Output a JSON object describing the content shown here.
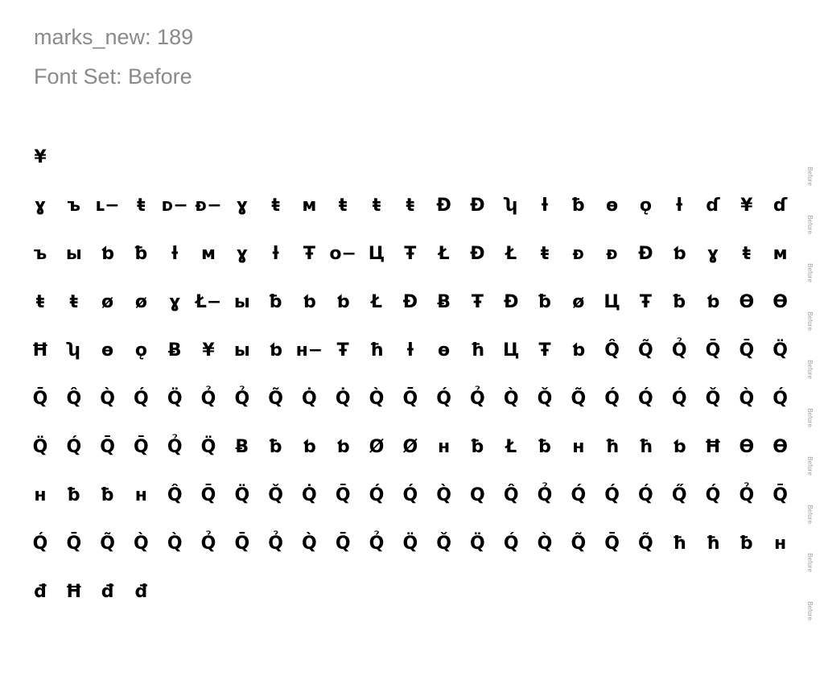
{
  "header": {
    "count_label": "marks_new: 189",
    "font_set_label": "Font Set: Before"
  },
  "side_label": "Before",
  "rows": [
    [
      "¥"
    ],
    [
      "ɣ",
      "ъ",
      "ʟ−",
      "ŧ",
      "ᴅ−",
      "ᴆ−",
      "ɣ",
      "ŧ",
      "ᴍ",
      "ŧ",
      "ŧ",
      "ŧ",
      "Đ",
      "Đ",
      "ʮ",
      "ƚ",
      "ƀ",
      "ɵ",
      "ǫ",
      "ƚ",
      "ɗ",
      "¥",
      "ɗ"
    ],
    [
      "ъ",
      "ы",
      "ƅ",
      "ƀ",
      "ƚ",
      "ᴍ",
      "ɣ",
      "ƚ",
      "Ŧ",
      "ᴏ−",
      "Ц",
      "Ŧ",
      "Ł",
      "Đ",
      "Ł",
      "ŧ",
      "ᴆ",
      "ᴆ",
      "Đ",
      "ƅ",
      "ɣ",
      "ŧ",
      "ᴍ"
    ],
    [
      "ŧ",
      "ŧ",
      "ø",
      "ø",
      "ɣ",
      "Ł−",
      "ы",
      "ƀ",
      "ƅ",
      "ƅ",
      "Ł",
      "Đ",
      "Ƀ",
      "Ŧ",
      "Đ",
      "ƀ",
      "ø",
      "Ц",
      "Ŧ",
      "ƀ",
      "ƅ",
      "Ɵ",
      "Ɵ"
    ],
    [
      "Ħ",
      "ʮ",
      "ɵ",
      "ǫ",
      "Ƀ",
      "¥",
      "ы",
      "ƅ",
      "ʜ−",
      "Ŧ",
      "ħ",
      "ƚ",
      "ɵ",
      "ħ",
      "Ц",
      "Ŧ",
      "ƅ",
      "Q̂",
      "Q̃",
      "Q̉",
      "Q̄",
      "Q̄",
      "Q̈"
    ],
    [
      "Q̄",
      "Q̂",
      "Q̀",
      "Q́",
      "Q̈",
      "Q̉",
      "Q̉",
      "Q̃",
      "Q̇",
      "Q̇",
      "Q̀",
      "Q̄",
      "Q́",
      "Q̉",
      "Q̀",
      "Q̌",
      "Q̃",
      "Q́",
      "Q́",
      "Q́",
      "Q̌",
      "Q̀",
      "Q́"
    ],
    [
      "Q̈",
      "Q́",
      "Q̄",
      "Q̄",
      "Q̉",
      "Q̈",
      "Ƀ",
      "ƀ",
      "ƅ",
      "ƅ",
      "Ø",
      "Ø",
      "ʜ",
      "ƀ",
      "Ł",
      "ƀ",
      "ʜ",
      "ħ",
      "ħ",
      "ƅ",
      "Ħ",
      "Ɵ",
      "Ɵ"
    ],
    [
      "ʜ",
      "ƀ",
      "ƀ",
      "ʜ",
      "Q̂",
      "Q̄",
      "Q̈",
      "Q̌",
      "Q̇",
      "Q̄",
      "Q́",
      "Q́",
      "Q̀",
      "Q",
      "Q̂",
      "Q̉",
      "Q́",
      "Q́",
      "Q́",
      "Q̋",
      "Q́",
      "Q̉",
      "Q̄"
    ],
    [
      "Q́",
      "Q̄",
      "Q̃",
      "Q̀",
      "Q̀",
      "Q̉",
      "Q̄",
      "Q̉",
      "Q̀",
      "Q̄",
      "Q̉",
      "Q̈",
      "Q̌",
      "Q̈",
      "Q́",
      "Q̀",
      "Q̃",
      "Q̄",
      "Q̃",
      "ħ",
      "ħ",
      "ƀ",
      "ʜ"
    ],
    [
      "đ",
      "Ħ",
      "đ",
      "đ"
    ]
  ]
}
